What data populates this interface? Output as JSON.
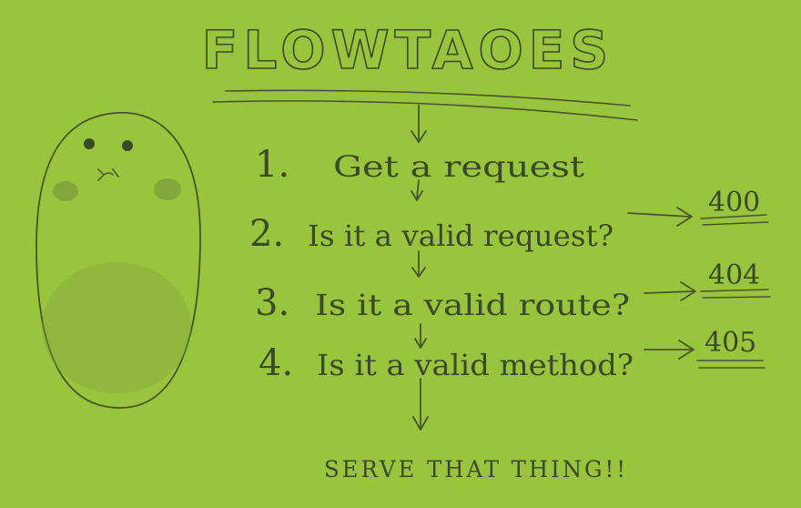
{
  "title": "FLOWTAOES",
  "steps": [
    {
      "number": "1.",
      "text": "Get a request",
      "outcome": ""
    },
    {
      "number": "2.",
      "text": "Is it a valid request?",
      "outcome": "400"
    },
    {
      "number": "3.",
      "text": "Is it a valid route?",
      "outcome": "404"
    },
    {
      "number": "4.",
      "text": "Is it a valid method?",
      "outcome": "405"
    }
  ],
  "final": "SERVE THAT THING!!",
  "colors": {
    "paper": "#98c43e",
    "pencil": "#3b4a26",
    "potato_cheeks": "#6f8f3a"
  }
}
